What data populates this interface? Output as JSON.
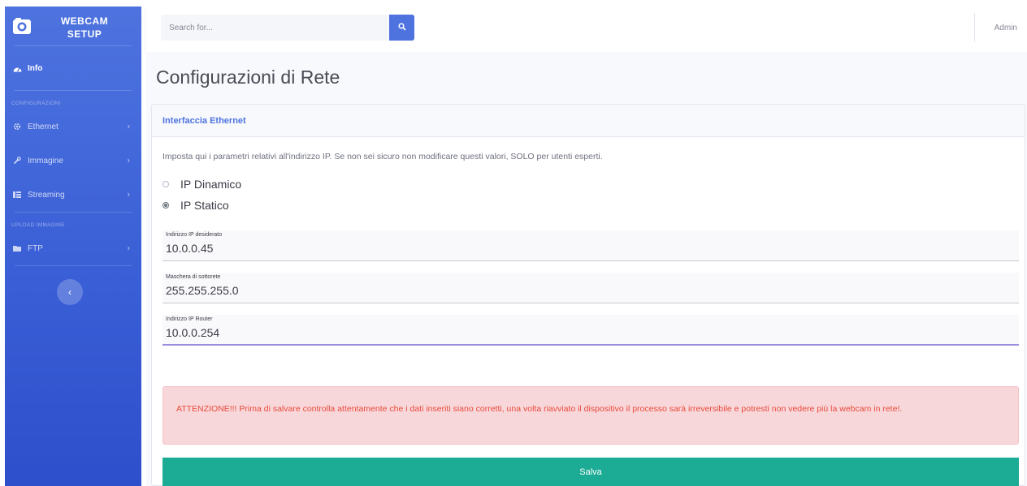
{
  "brand": {
    "line1": "WEBCAM",
    "line2": "SETUP",
    "icon": "camera-icon"
  },
  "sidebar": {
    "active_item": {
      "label": "Info",
      "icon": "tachometer-icon"
    },
    "heading_config": "CONFIGURAZIONI",
    "config_items": [
      {
        "label": "Ethernet",
        "icon": "gear-icon"
      },
      {
        "label": "Immagine",
        "icon": "wrench-icon"
      },
      {
        "label": "Streaming",
        "icon": "columns-icon"
      }
    ],
    "heading_upload": "UPLOAD IMMAGINE",
    "upload_items": [
      {
        "label": "FTP",
        "icon": "folder-icon"
      }
    ],
    "toggle_icon": "chevron-left-icon"
  },
  "topbar": {
    "search_placeholder": "Search for...",
    "search_icon": "search-icon",
    "user_name": "Admin"
  },
  "page": {
    "title": "Configurazioni di Rete",
    "card_title": "Interfaccia Ethernet",
    "description": "Imposta qui i parametri relativi all'indirizzo IP. Se non sei sicuro non modificare questi valori, SOLO per utenti esperti.",
    "radio_options": [
      {
        "label": "IP Dinamico",
        "checked": false
      },
      {
        "label": "IP Statico",
        "checked": true
      }
    ],
    "fields": [
      {
        "label": "Indirizzo IP desiderato",
        "value": "10.0.0.45"
      },
      {
        "label": "Maschera di sottorete",
        "value": "255.255.255.0"
      },
      {
        "label": "Indirizzo IP Router",
        "value": "10.0.0.254"
      }
    ],
    "alert": "ATTENZIONE!!! Prima di salvare controlla attentamente che i dati inseriti siano corretti, una volta riavviato il dispositivo il processo sarà irreversibile e potresti non vedere più la webcam in rete!.",
    "save_label": "Salva"
  },
  "colors": {
    "sidebar_primary": "#4e73df",
    "accent": "#4e73df",
    "alert_bg": "#f8d7da",
    "alert_text": "#e74a3b",
    "save_button": "#1cab95"
  }
}
